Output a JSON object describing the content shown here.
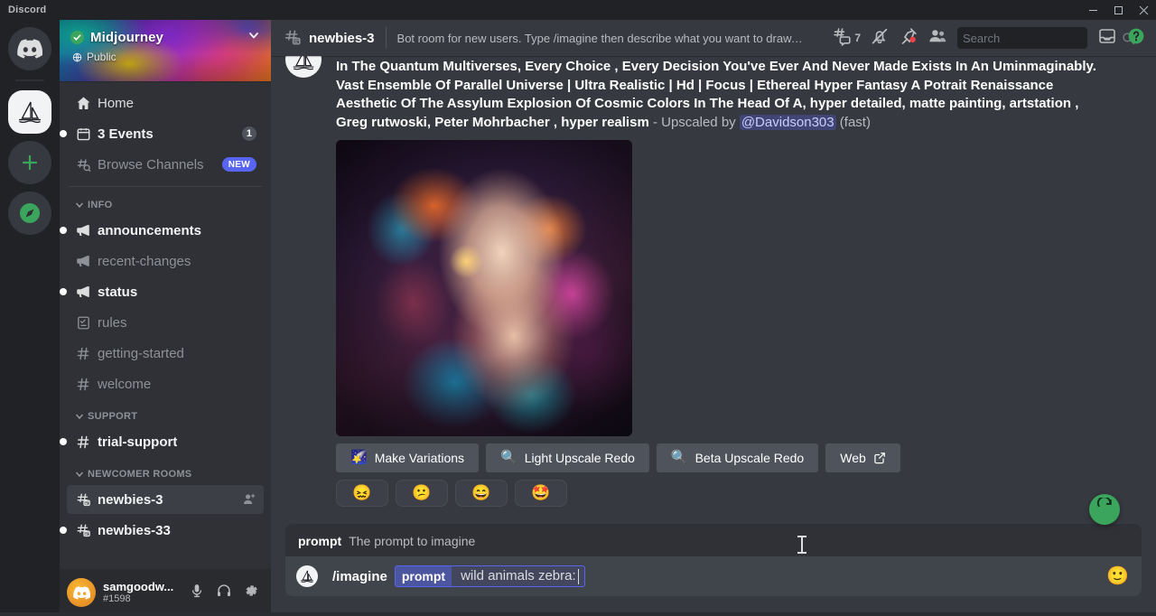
{
  "window": {
    "app_title": "Discord",
    "minimize_label": "Minimize",
    "maximize_label": "Maximize",
    "close_label": "Close"
  },
  "server_rail": {
    "items": [
      {
        "name": "discord-home",
        "label": "Discord",
        "icon": "discord-icon",
        "active": false
      },
      {
        "name": "server-midjourney",
        "label": "Midjourney",
        "icon": "sailboat-icon",
        "active": true
      },
      {
        "name": "add-server",
        "label": "Add a Server",
        "icon": "plus-icon",
        "active": false
      },
      {
        "name": "explore-servers",
        "label": "Explore Public Servers",
        "icon": "compass-icon",
        "active": false
      }
    ]
  },
  "sidebar": {
    "server": {
      "name": "Midjourney",
      "verified": true,
      "privacy": "Public"
    },
    "top_items": [
      {
        "label": "Home",
        "icon": "home-icon",
        "state": "bright",
        "badge": ""
      },
      {
        "label": "3 Events",
        "icon": "calendar-icon",
        "state": "unread",
        "badge": "1"
      },
      {
        "label": "Browse Channels",
        "icon": "browse-channels-icon",
        "state": "normal",
        "badge": "NEW"
      }
    ],
    "categories": [
      {
        "name": "INFO",
        "channels": [
          {
            "label": "announcements",
            "icon": "announcement-icon",
            "state": "unread"
          },
          {
            "label": "recent-changes",
            "icon": "announcement-icon",
            "state": "normal"
          },
          {
            "label": "status",
            "icon": "announcement-icon",
            "state": "unread"
          },
          {
            "label": "rules",
            "icon": "rules-icon",
            "state": "normal"
          },
          {
            "label": "getting-started",
            "icon": "hash-icon",
            "state": "normal"
          },
          {
            "label": "welcome",
            "icon": "hash-icon",
            "state": "normal"
          }
        ]
      },
      {
        "name": "SUPPORT",
        "channels": [
          {
            "label": "trial-support",
            "icon": "hash-icon",
            "state": "unread"
          }
        ]
      },
      {
        "name": "NEWCOMER ROOMS",
        "channels": [
          {
            "label": "newbies-3",
            "icon": "forum-icon",
            "state": "active",
            "trailing_icon": "add-member-icon"
          },
          {
            "label": "newbies-33",
            "icon": "forum-icon",
            "state": "unread"
          }
        ]
      }
    ],
    "user": {
      "name": "samgoodw...",
      "tag": "#1598",
      "buttons": [
        {
          "name": "mute-microphone-button",
          "icon": "microphone-icon"
        },
        {
          "name": "deafen-button",
          "icon": "headphones-icon"
        },
        {
          "name": "user-settings-button",
          "icon": "gear-icon"
        }
      ]
    }
  },
  "channel_header": {
    "name": "newbies-3",
    "topic": "Bot room for new users. Type /imagine then describe what you want to draw. S...",
    "threads_count": "7",
    "tools": [
      {
        "name": "threads-button",
        "icon": "threads-icon"
      },
      {
        "name": "notification-settings-button",
        "icon": "bell-muted-icon"
      },
      {
        "name": "pinned-messages-button",
        "icon": "pin-icon"
      },
      {
        "name": "member-list-button",
        "icon": "members-icon"
      }
    ],
    "search_placeholder": "Search",
    "search_value": "",
    "right_tools": [
      {
        "name": "inbox-button",
        "icon": "inbox-icon"
      },
      {
        "name": "help-button",
        "icon": "help-icon"
      }
    ]
  },
  "message": {
    "prompt_bold": "In The Quantum Multiverses, Every Choice , Every Decision You've Ever And Never Made Exists In An Uminmaginably. Vast Ensemble Of Parallel Universe | Ultra Realistic | Hd | Focus | Ethereal Hyper Fantasy A Potrait Renaissance Aesthetic Of The Assylum Explosion Of Cosmic Colors In The Head Of A, hyper detailed, matte painting, artstation , Greg rutwoski, Peter Mohrbacher , hyper realism",
    "upscaled_by_label": " - Upscaled by ",
    "mention": "@Davidson303",
    "speed_note": " (fast)",
    "image_alt": "cosmic-face-portrait",
    "buttons": [
      {
        "name": "make-variations-button",
        "label": "Make Variations",
        "emoji": "🌠"
      },
      {
        "name": "light-upscale-redo-button",
        "label": "Light Upscale Redo",
        "emoji": "🔍"
      },
      {
        "name": "beta-upscale-redo-button",
        "label": "Beta Upscale Redo",
        "emoji": "🔍"
      },
      {
        "name": "web-button",
        "label": "Web",
        "emoji": ""
      }
    ],
    "web_button_icon": "external-link-icon",
    "reactions": [
      {
        "name": "reaction-confounded",
        "emoji": "😖"
      },
      {
        "name": "reaction-frowning",
        "emoji": "😕"
      },
      {
        "name": "reaction-grin",
        "emoji": "😄"
      },
      {
        "name": "reaction-star-struck",
        "emoji": "🤩"
      }
    ]
  },
  "composer": {
    "hint_option_name": "prompt",
    "hint_option_desc": "The prompt to imagine",
    "command_name": "/imagine",
    "option_key": "prompt",
    "option_value": "wild animals zebra:",
    "emoji_button_icon": "emoji-icon",
    "regenerate_button_icon": "refresh-icon"
  },
  "colors": {
    "accent": "#5865f2",
    "green": "#3ba55d",
    "sidebar_bg": "#2f3136",
    "main_bg": "#36393f",
    "rail_bg": "#202225",
    "button_bg": "#4f545c"
  }
}
